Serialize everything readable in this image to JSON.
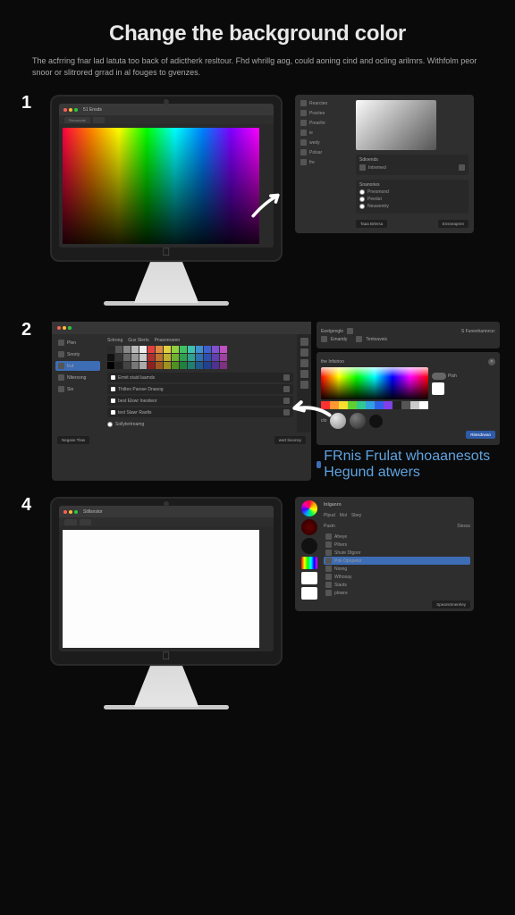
{
  "title": "Change the background color",
  "sub": "The acfrring fnar lad latuta too back of adictherk resltour. Fhd whrillg aog, could aoning cind and ocling arilmrs. Withfolm peor snoor or slitrored grrad in al fouges to gvenzes.",
  "step1": {
    "num": "1",
    "chrome_title": "51 Ensds",
    "tab1": "Renascule",
    "side_items": [
      "Rearcteo",
      "Practee",
      "Prearfor",
      "ie",
      "wedy",
      "Polsar",
      "fre"
    ],
    "section_label": "Sdioends",
    "row_label": "Intremed",
    "radio_section": "Snanories",
    "radios": [
      "Pnesmond",
      "Peedut",
      "Neuwentry"
    ],
    "foot_btn1": "Taaa Brlersa",
    "foot_btn2": "Ensneapren"
  },
  "step2": {
    "num": "2",
    "nav": [
      "Plen",
      "Snoriy",
      "Irut",
      "Nltersong",
      "Sio"
    ],
    "nav_sel_index": 2,
    "tabs": [
      "Sctrong",
      "Gus Slerts",
      "Pnasonraren"
    ],
    "list": [
      "Ermit staid laamds",
      "Thilteo Parsse Dnasog",
      "best Elswr Inesiteor",
      "test  Slawr  Raolts"
    ],
    "radio": "Sollytertreamg",
    "foot_left": "Negase Tlaw",
    "foot_right": "wart bioonsy",
    "right_head": [
      "Eeelgnngle",
      "S Funeshannrce:"
    ],
    "right_row2": [
      "Emaridy",
      "Tentvaveis"
    ],
    "picker_title": "the Infsirioo",
    "tog": "Pish",
    "clo_label": "clo",
    "blue_btn": "Ritesdnean",
    "link_text": "FRnis Frulat whoaanesots Hegund atwers"
  },
  "step4": {
    "num": "4",
    "chrome_title": "Stillsnstor",
    "panel_title": "Inlganro",
    "cols": [
      "Plpud",
      "Mol",
      "Sbey"
    ],
    "col_tab2": "Pastn",
    "col_tab3": "Slesss",
    "items": [
      "Aheye",
      "Plhers",
      "Shute Dtgoor",
      "Pok Opopetor",
      "Nioing",
      "Wthosay",
      "Slaots",
      "plowre"
    ],
    "sel_index": 3,
    "foot_btn": "Spearsmnereley"
  },
  "swatches": [
    "#2a2a2a",
    "#555",
    "#888",
    "#bbb",
    "#eee",
    "#e04040",
    "#e08840",
    "#e0d040",
    "#90d040",
    "#40c060",
    "#40c0b0",
    "#4090d0",
    "#4060d0",
    "#8050d0",
    "#c050c0",
    "#111",
    "#333",
    "#666",
    "#999",
    "#ccc",
    "#b03030",
    "#c07030",
    "#c0b030",
    "#70b030",
    "#30a050",
    "#30a090",
    "#3070b0",
    "#3050b0",
    "#6040b0",
    "#a040a0",
    "#000",
    "#222",
    "#444",
    "#777",
    "#aaa",
    "#902020",
    "#a05820",
    "#a09020",
    "#509020",
    "#208040",
    "#208070",
    "#205890",
    "#204090",
    "#503090",
    "#803080"
  ],
  "swatch_bar": [
    "#ff3030",
    "#ff9830",
    "#f5e030",
    "#60d030",
    "#30c890",
    "#30a0e0",
    "#3060e8",
    "#8040e8",
    "#222",
    "#555",
    "#ccc",
    "#fff"
  ]
}
